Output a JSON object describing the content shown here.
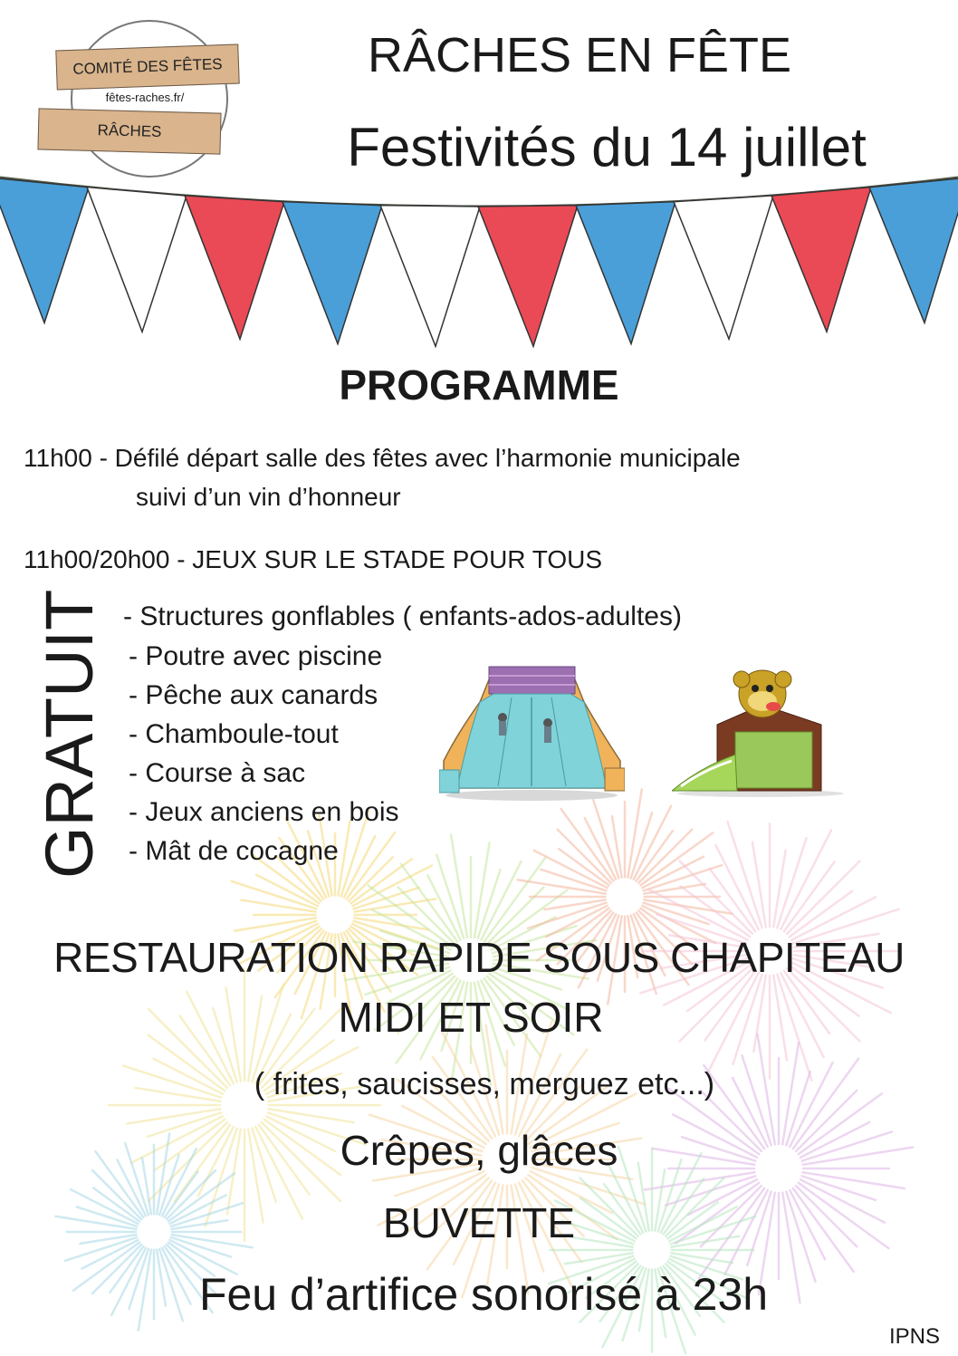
{
  "logo": {
    "top_banner": "COMITÉ DES FÊTES",
    "website": "fêtes-raches.fr/",
    "bottom_banner": "RÂCHES"
  },
  "header": {
    "title": "RÂCHES EN FÊTE",
    "subtitle": "Festivités du 14 juillet"
  },
  "colors": {
    "blue": "#4a9fd8",
    "red": "#ea4a55",
    "white": "#ffffff",
    "garland_string": "#4f5a48"
  },
  "garland": {
    "pattern": [
      "blue",
      "white",
      "red",
      "blue",
      "white",
      "red",
      "blue",
      "white",
      "red",
      "blue"
    ]
  },
  "programme": {
    "heading": "PROGRAMME",
    "item1_time": "11h00 - Défilé départ salle des fêtes avec l’harmonie municipale",
    "item1_cont": "suivi d’un vin d’honneur",
    "item2": "11h00/20h00 - JEUX SUR LE STADE POUR TOUS"
  },
  "gratuit": {
    "label": "GRATUIT",
    "activities": [
      "- Structures gonflables ( enfants-ados-adultes)",
      "- Poutre avec piscine",
      "- Pêche aux canards",
      "- Chamboule-tout",
      "- Course à sac",
      "- Jeux anciens en bois",
      "- Mât de cocagne"
    ]
  },
  "food": {
    "line1": "RESTAURATION RAPIDE SOUS CHAPITEAU",
    "line2": "MIDI ET SOIR",
    "line3": "( frites, saucisses, merguez etc...)",
    "line4": "Crêpes, glâces",
    "line5": "BUVETTE",
    "line6": "Feu d’artifice sonorisé à 23h"
  },
  "footer": {
    "ipns": "IPNS"
  }
}
